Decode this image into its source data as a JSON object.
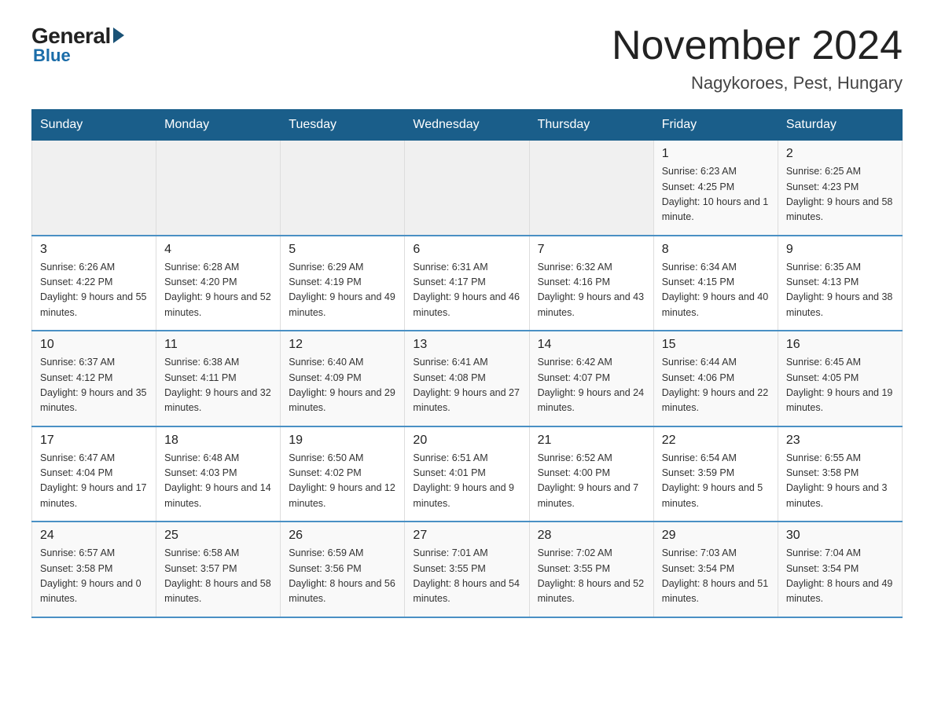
{
  "logo": {
    "general": "General",
    "blue": "Blue"
  },
  "header": {
    "month": "November 2024",
    "location": "Nagykoroes, Pest, Hungary"
  },
  "weekdays": [
    "Sunday",
    "Monday",
    "Tuesday",
    "Wednesday",
    "Thursday",
    "Friday",
    "Saturday"
  ],
  "weeks": [
    [
      {
        "day": "",
        "info": ""
      },
      {
        "day": "",
        "info": ""
      },
      {
        "day": "",
        "info": ""
      },
      {
        "day": "",
        "info": ""
      },
      {
        "day": "",
        "info": ""
      },
      {
        "day": "1",
        "info": "Sunrise: 6:23 AM\nSunset: 4:25 PM\nDaylight: 10 hours and 1 minute."
      },
      {
        "day": "2",
        "info": "Sunrise: 6:25 AM\nSunset: 4:23 PM\nDaylight: 9 hours and 58 minutes."
      }
    ],
    [
      {
        "day": "3",
        "info": "Sunrise: 6:26 AM\nSunset: 4:22 PM\nDaylight: 9 hours and 55 minutes."
      },
      {
        "day": "4",
        "info": "Sunrise: 6:28 AM\nSunset: 4:20 PM\nDaylight: 9 hours and 52 minutes."
      },
      {
        "day": "5",
        "info": "Sunrise: 6:29 AM\nSunset: 4:19 PM\nDaylight: 9 hours and 49 minutes."
      },
      {
        "day": "6",
        "info": "Sunrise: 6:31 AM\nSunset: 4:17 PM\nDaylight: 9 hours and 46 minutes."
      },
      {
        "day": "7",
        "info": "Sunrise: 6:32 AM\nSunset: 4:16 PM\nDaylight: 9 hours and 43 minutes."
      },
      {
        "day": "8",
        "info": "Sunrise: 6:34 AM\nSunset: 4:15 PM\nDaylight: 9 hours and 40 minutes."
      },
      {
        "day": "9",
        "info": "Sunrise: 6:35 AM\nSunset: 4:13 PM\nDaylight: 9 hours and 38 minutes."
      }
    ],
    [
      {
        "day": "10",
        "info": "Sunrise: 6:37 AM\nSunset: 4:12 PM\nDaylight: 9 hours and 35 minutes."
      },
      {
        "day": "11",
        "info": "Sunrise: 6:38 AM\nSunset: 4:11 PM\nDaylight: 9 hours and 32 minutes."
      },
      {
        "day": "12",
        "info": "Sunrise: 6:40 AM\nSunset: 4:09 PM\nDaylight: 9 hours and 29 minutes."
      },
      {
        "day": "13",
        "info": "Sunrise: 6:41 AM\nSunset: 4:08 PM\nDaylight: 9 hours and 27 minutes."
      },
      {
        "day": "14",
        "info": "Sunrise: 6:42 AM\nSunset: 4:07 PM\nDaylight: 9 hours and 24 minutes."
      },
      {
        "day": "15",
        "info": "Sunrise: 6:44 AM\nSunset: 4:06 PM\nDaylight: 9 hours and 22 minutes."
      },
      {
        "day": "16",
        "info": "Sunrise: 6:45 AM\nSunset: 4:05 PM\nDaylight: 9 hours and 19 minutes."
      }
    ],
    [
      {
        "day": "17",
        "info": "Sunrise: 6:47 AM\nSunset: 4:04 PM\nDaylight: 9 hours and 17 minutes."
      },
      {
        "day": "18",
        "info": "Sunrise: 6:48 AM\nSunset: 4:03 PM\nDaylight: 9 hours and 14 minutes."
      },
      {
        "day": "19",
        "info": "Sunrise: 6:50 AM\nSunset: 4:02 PM\nDaylight: 9 hours and 12 minutes."
      },
      {
        "day": "20",
        "info": "Sunrise: 6:51 AM\nSunset: 4:01 PM\nDaylight: 9 hours and 9 minutes."
      },
      {
        "day": "21",
        "info": "Sunrise: 6:52 AM\nSunset: 4:00 PM\nDaylight: 9 hours and 7 minutes."
      },
      {
        "day": "22",
        "info": "Sunrise: 6:54 AM\nSunset: 3:59 PM\nDaylight: 9 hours and 5 minutes."
      },
      {
        "day": "23",
        "info": "Sunrise: 6:55 AM\nSunset: 3:58 PM\nDaylight: 9 hours and 3 minutes."
      }
    ],
    [
      {
        "day": "24",
        "info": "Sunrise: 6:57 AM\nSunset: 3:58 PM\nDaylight: 9 hours and 0 minutes."
      },
      {
        "day": "25",
        "info": "Sunrise: 6:58 AM\nSunset: 3:57 PM\nDaylight: 8 hours and 58 minutes."
      },
      {
        "day": "26",
        "info": "Sunrise: 6:59 AM\nSunset: 3:56 PM\nDaylight: 8 hours and 56 minutes."
      },
      {
        "day": "27",
        "info": "Sunrise: 7:01 AM\nSunset: 3:55 PM\nDaylight: 8 hours and 54 minutes."
      },
      {
        "day": "28",
        "info": "Sunrise: 7:02 AM\nSunset: 3:55 PM\nDaylight: 8 hours and 52 minutes."
      },
      {
        "day": "29",
        "info": "Sunrise: 7:03 AM\nSunset: 3:54 PM\nDaylight: 8 hours and 51 minutes."
      },
      {
        "day": "30",
        "info": "Sunrise: 7:04 AM\nSunset: 3:54 PM\nDaylight: 8 hours and 49 minutes."
      }
    ]
  ]
}
